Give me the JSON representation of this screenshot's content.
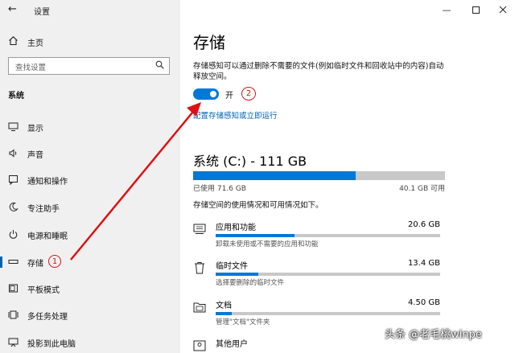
{
  "window": {
    "title": "设置"
  },
  "sidebar": {
    "home_label": "主页",
    "search_placeholder": "查找设置",
    "section_title": "系统",
    "items": [
      {
        "label": "显示",
        "icon": "monitor-icon"
      },
      {
        "label": "声音",
        "icon": "speaker-icon"
      },
      {
        "label": "通知和操作",
        "icon": "notification-icon"
      },
      {
        "label": "专注助手",
        "icon": "moon-icon"
      },
      {
        "label": "电源和睡眠",
        "icon": "power-icon"
      },
      {
        "label": "存储",
        "icon": "storage-icon",
        "selected": true
      },
      {
        "label": "平板模式",
        "icon": "tablet-icon"
      },
      {
        "label": "多任务处理",
        "icon": "multitask-icon"
      },
      {
        "label": "投影到此电脑",
        "icon": "project-icon"
      }
    ]
  },
  "main": {
    "title": "存储",
    "sense_description": "存储感知可以通过删除不需要的文件(例如临时文件和回收站中的内容)自动释放空间。",
    "toggle_state": "开",
    "configure_link": "配置存储感知或立即运行",
    "drive_title": "系统 (C:) - 111 GB",
    "used_label": "已使用 71.6 GB",
    "free_label": "40.1 GB 可用",
    "used_fraction": 0.645,
    "usage_info": "存储空间的使用情况和可用情况如下。",
    "categories": [
      {
        "name": "应用和功能",
        "size": "20.6 GB",
        "desc": "卸载未使用或不需要的应用和功能",
        "fraction": 0.35,
        "icon": "apps-icon"
      },
      {
        "name": "临时文件",
        "size": "13.4 GB",
        "desc": "选择要删除的临时文件",
        "fraction": 0.19,
        "icon": "trash-icon"
      },
      {
        "name": "文档",
        "size": "4.50 GB",
        "desc": "管理\"文档\"文件夹",
        "fraction": 0.07,
        "icon": "folder-icon"
      },
      {
        "name": "其他用户",
        "size": "",
        "desc": "",
        "fraction": 0,
        "icon": "users-icon"
      }
    ]
  },
  "annotations": {
    "step1": "1",
    "step2": "2"
  },
  "watermark": "头条 @老毛桃winpe",
  "colors": {
    "accent": "#0078d7",
    "annotation": "#dd1111",
    "bar_bg": "#c8c8c8",
    "sidebar_bg": "#f0f0f0"
  }
}
